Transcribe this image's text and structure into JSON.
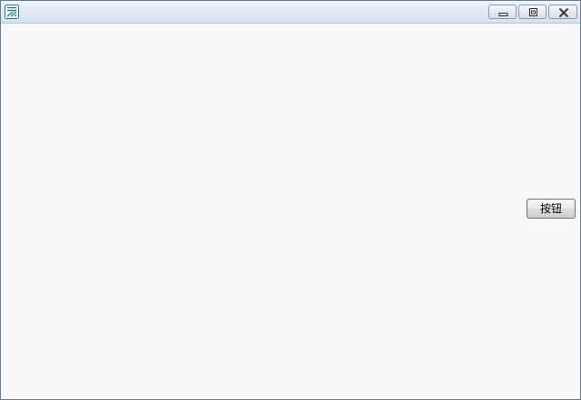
{
  "window": {
    "icon": "app-logo-icon",
    "controls": {
      "minimize_icon": "minimize-icon",
      "maximize_icon": "restore-icon",
      "close_icon": "close-icon"
    }
  },
  "content": {
    "button_label": "按钮"
  },
  "colors": {
    "titlebar_top": "#eef3fa",
    "titlebar_bottom": "#d6e1ef",
    "client_bg": "#f8f8f8",
    "icon_teal": "#1f7f86"
  }
}
